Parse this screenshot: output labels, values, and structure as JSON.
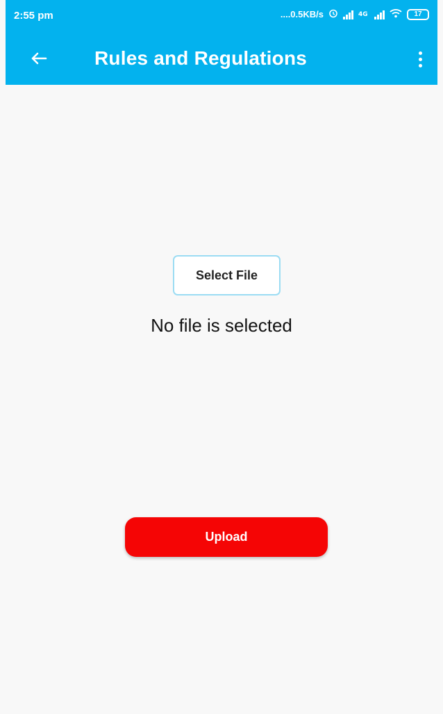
{
  "status_bar": {
    "time": "2:55 pm",
    "network_speed": "....0.5KB/s",
    "battery": "17",
    "icons": [
      "alarm-icon",
      "signal-icon",
      "lte-icon",
      "signal-icon",
      "wifi-icon",
      "battery-icon"
    ]
  },
  "app_bar": {
    "title": "Rules and Regulations",
    "back_icon": "arrow-left-icon",
    "menu_icon": "more-vert-icon",
    "background": "#03b2ee"
  },
  "main": {
    "select_file_label": "Select File",
    "status_text": "No file is selected",
    "upload_label": "Upload",
    "upload_color": "#f50505"
  }
}
